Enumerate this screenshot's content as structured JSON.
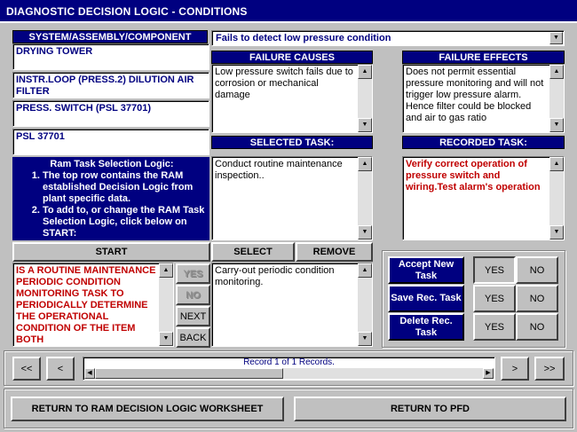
{
  "window": {
    "title": "DIAGNOSTIC DECISION LOGIC - CONDITIONS"
  },
  "system": {
    "header": "SYSTEM/ASSEMBLY/COMPONENT",
    "items": [
      "DRYING TOWER",
      "INSTR.LOOP (PRESS.2) DILUTION AIR FILTER",
      "PRESS. SWITCH (PSL 37701)",
      "PSL 37701"
    ]
  },
  "failure_mode": {
    "value": "Fails to detect low pressure condition"
  },
  "failure_causes": {
    "header": "FAILURE CAUSES",
    "text": "Low pressure switch fails due to corrosion or mechanical damage"
  },
  "failure_effects": {
    "header": "FAILURE EFFECTS",
    "text": "Does not permit essential pressure monitoring and will not trigger low pressure alarm. Hence filter could be blocked and air to gas ratio"
  },
  "task_logic": {
    "title": "Ram Task Selection Logic:",
    "steps": [
      "The top row contains the RAM established Decision Logic from plant specific data.",
      "To add to, or change the RAM Task Selection Logic, click below on START:"
    ]
  },
  "selected_task": {
    "header": "SELECTED TASK:",
    "text": "Conduct routine maintenance inspection.."
  },
  "recorded_task": {
    "header": "RECORDED TASK:",
    "text": "Verify correct operation of pressure switch and wiring.Test alarm's operation"
  },
  "buttons": {
    "start": "START",
    "select": "SELECT",
    "remove": "REMOVE",
    "yes": "YES",
    "no": "NO",
    "next": "NEXT",
    "back": "BACK",
    "first": "<<",
    "prev": "<",
    "nextrec": ">",
    "last": ">>",
    "return_ram": "RETURN TO RAM DECISION LOGIC WORKSHEET",
    "return_pfd": "RETURN TO PFD"
  },
  "question": {
    "text": "IS A ROUTINE MAINTENANCE PERIODIC CONDITION MONITORING TASK TO PERIODICALLY DETERMINE THE OPERATIONAL CONDITION OF THE ITEM BOTH"
  },
  "candidate_task": {
    "text": "Carry-out periodic condition monitoring."
  },
  "actions": [
    {
      "label": "Accept New Task",
      "yes": "YES",
      "no": "NO"
    },
    {
      "label": "Save Rec. Task",
      "yes": "YES",
      "no": "NO"
    },
    {
      "label": "Delete Rec. Task",
      "yes": "YES",
      "no": "NO"
    }
  ],
  "record": {
    "status": "Record 1 of 1 Records."
  }
}
